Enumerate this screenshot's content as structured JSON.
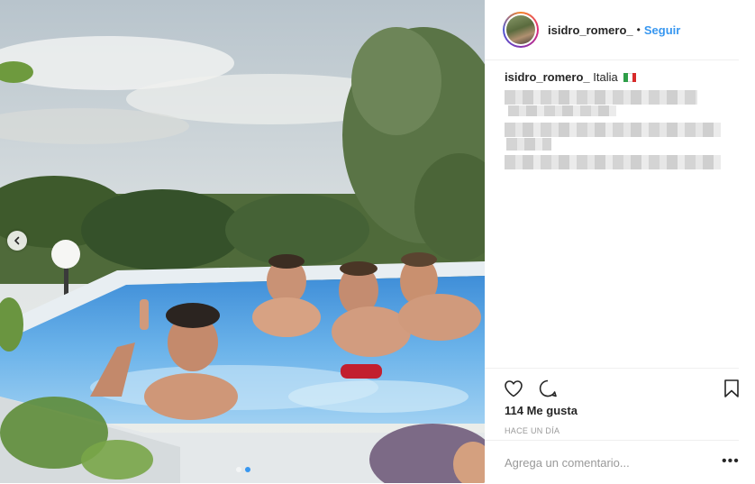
{
  "post": {
    "username": "isidro_romero_",
    "separator": "•",
    "follow_label": "Seguir",
    "caption_user": "isidro_romero_",
    "location": "Italia",
    "likes": "114 Me gusta",
    "time": "HACE UN DÍA",
    "comment_placeholder": "Agrega un comentario...",
    "more_label": "•••"
  },
  "carousel": {
    "total": 2,
    "current": 2
  },
  "colors": {
    "accent": "#3897f0",
    "text": "#262626",
    "muted": "#999999",
    "border": "#efefef"
  },
  "icons": [
    "chevron-left-icon",
    "heart-icon",
    "comment-icon",
    "bookmark-icon",
    "more-icon",
    "italy-flag-icon"
  ]
}
